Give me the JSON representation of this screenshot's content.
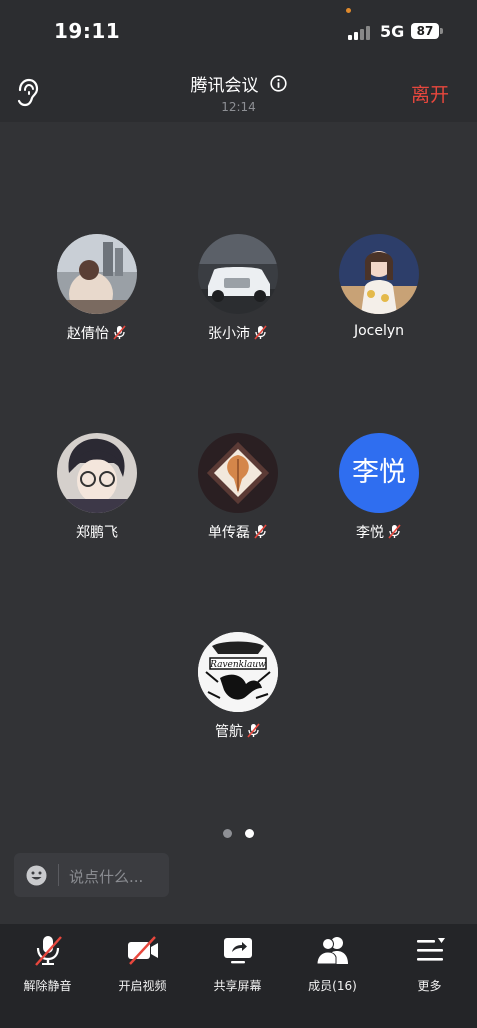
{
  "status_bar": {
    "time": "19:11",
    "network": "5G",
    "battery": "87"
  },
  "header": {
    "title": "腾讯会议",
    "duration": "12:14",
    "leave_label": "离开"
  },
  "participants": [
    {
      "name": "赵倩怡",
      "muted": true
    },
    {
      "name": "张小沛",
      "muted": true
    },
    {
      "name": "Jocelyn",
      "muted": false
    },
    {
      "name": "郑鹏飞",
      "muted": false
    },
    {
      "name": "单传磊",
      "muted": true
    },
    {
      "name": "李悦",
      "muted": true,
      "avatar_text": "李悦"
    },
    {
      "name": "管航",
      "muted": true
    }
  ],
  "pagination": {
    "total": 2,
    "current": 2
  },
  "chat": {
    "placeholder": "说点什么..."
  },
  "toolbar": {
    "items": [
      {
        "label": "解除静音",
        "icon": "mic-muted-icon"
      },
      {
        "label": "开启视频",
        "icon": "camera-off-icon"
      },
      {
        "label": "共享屏幕",
        "icon": "share-screen-icon"
      },
      {
        "label": "成员(16)",
        "icon": "members-icon"
      },
      {
        "label": "更多",
        "icon": "more-menu-icon"
      }
    ]
  },
  "colors": {
    "leave": "#e8473d",
    "muted_slash": "#e8473d",
    "avatar_blue": "#2f6ef0",
    "background": "#323336"
  }
}
